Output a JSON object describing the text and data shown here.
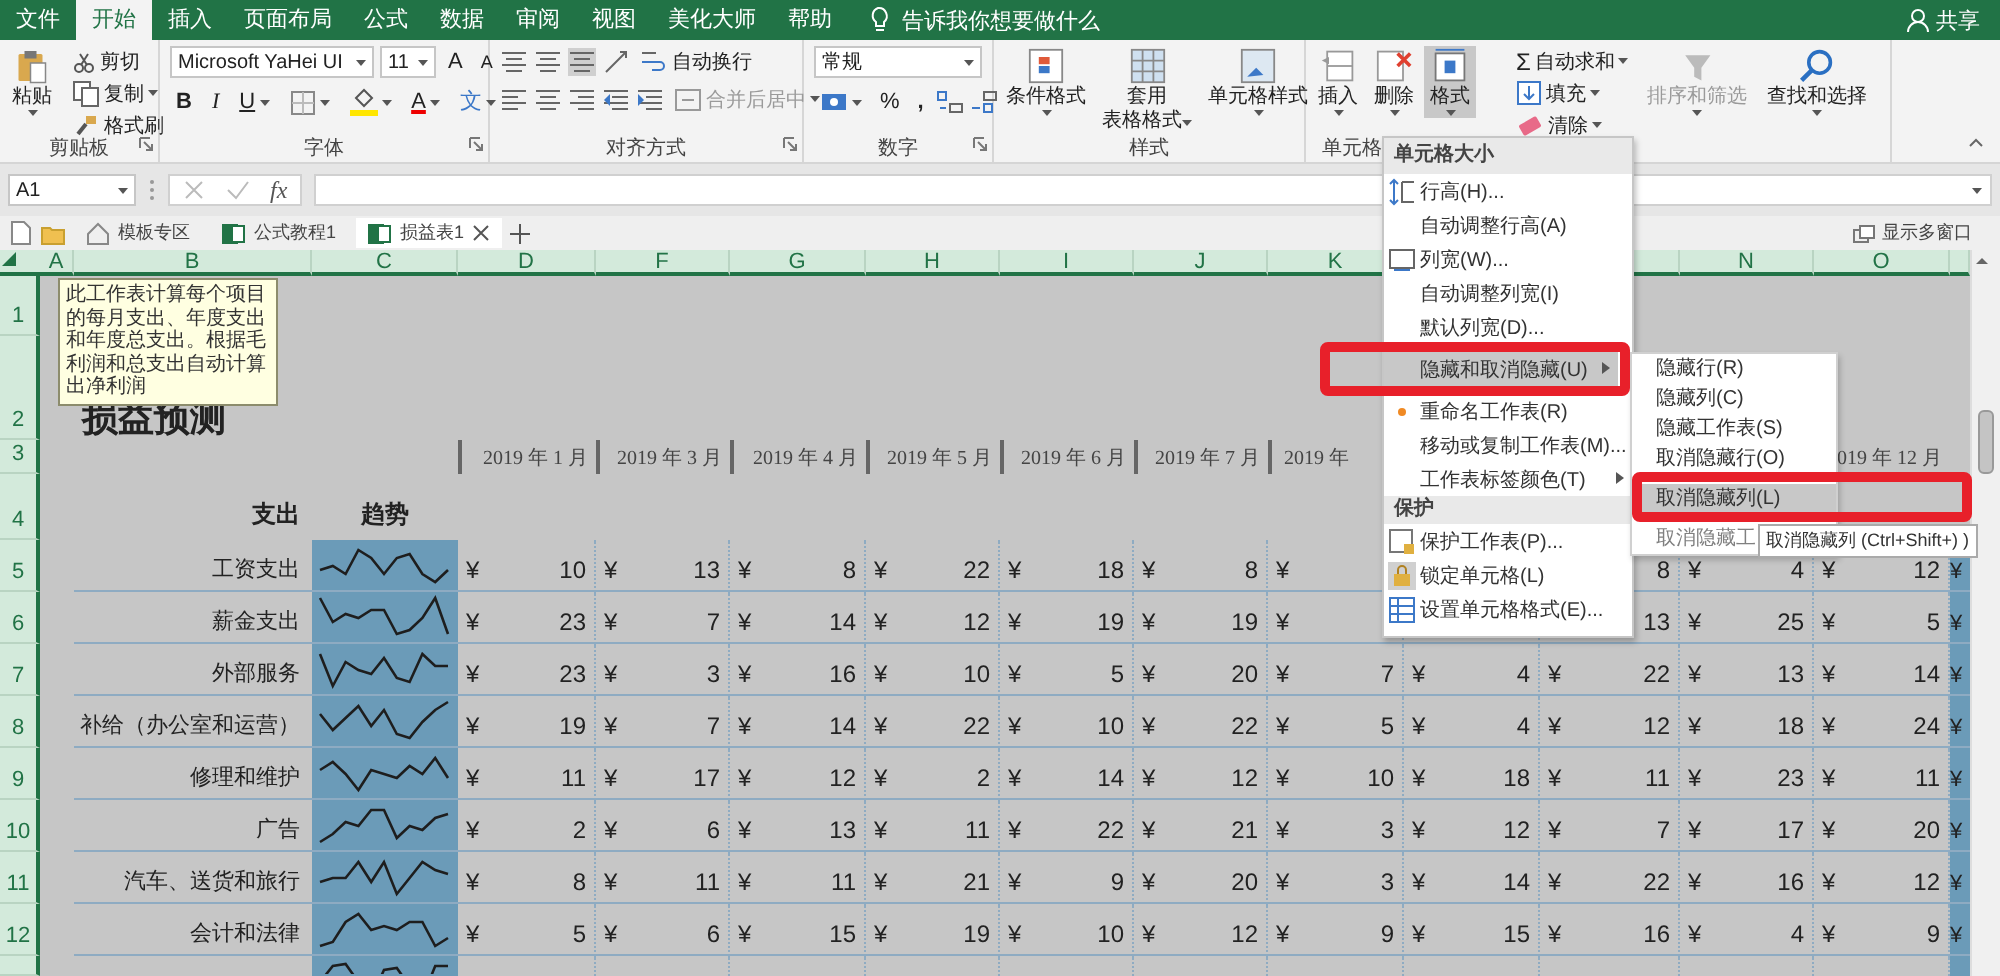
{
  "ribbon_tabs": [
    {
      "label": "文件",
      "selected": false
    },
    {
      "label": "开始",
      "selected": true
    },
    {
      "label": "插入",
      "selected": false
    },
    {
      "label": "页面布局",
      "selected": false
    },
    {
      "label": "公式",
      "selected": false
    },
    {
      "label": "数据",
      "selected": false
    },
    {
      "label": "审阅",
      "selected": false
    },
    {
      "label": "视图",
      "selected": false
    },
    {
      "label": "美化大师",
      "selected": false
    },
    {
      "label": "帮助",
      "selected": false
    }
  ],
  "tell_me": "告诉我你想要做什么",
  "share": "共享",
  "clipboard": {
    "paste": "粘贴",
    "cut": "剪切",
    "copy": "复制",
    "format_painter": "格式刷",
    "label": "剪贴板"
  },
  "font": {
    "name": "Microsoft YaHei UI",
    "size": "11",
    "grow": "A",
    "shrink": "A",
    "bold": "B",
    "italic": "I",
    "underline": "U",
    "font_color": "A",
    "phonetic": "文",
    "label": "字体"
  },
  "alignment": {
    "wrap": "自动换行",
    "merge": "合并后居中",
    "merge_disabled": true,
    "label": "对齐方式"
  },
  "number": {
    "format": "常规",
    "percent": "%",
    "comma": ",",
    "label": "数字"
  },
  "styles": {
    "conditional": "条件格式",
    "table": [
      "套用",
      "表格格式"
    ],
    "cell_styles": "单元格样式",
    "label": "样式"
  },
  "cells": {
    "insert": "插入",
    "delete": "删除",
    "format": "格式",
    "format_selected": true,
    "label": "单元格"
  },
  "editing": {
    "sum_sign": "Σ",
    "autosum": "自动求和",
    "fill": "填充",
    "clear": "清除",
    "sort": "排序和筛选",
    "sort_disabled": true,
    "find": "查找和选择"
  },
  "formula_bar": {
    "name_box": "A1",
    "fx": "fx"
  },
  "doc_tabs": [
    {
      "label": "模板专区",
      "kind": "home",
      "selected": false
    },
    {
      "label": "公式教程1",
      "kind": "excel",
      "selected": false
    },
    {
      "label": "损益表1",
      "kind": "excel",
      "selected": true
    }
  ],
  "multi_window": "显示多窗口",
  "columns": [
    {
      "label": "A"
    },
    {
      "label": "B"
    },
    {
      "label": "C"
    },
    {
      "label": "D"
    },
    {
      "label": "F"
    },
    {
      "label": "G"
    },
    {
      "label": "H"
    },
    {
      "label": "I"
    },
    {
      "label": "J"
    },
    {
      "label": "K"
    },
    {},
    {},
    {
      "label": "N"
    },
    {
      "label": "O"
    },
    {}
  ],
  "tooltip": "此工作表计算每个项目的每月支出、年度支出和年度总支出。根据毛利润和总支出自动计算出净利润",
  "rows": [
    {
      "kind": "blank",
      "num": "1"
    },
    {
      "kind": "title",
      "num": "2",
      "title": "损益预测"
    },
    {
      "kind": "dates",
      "num": "3",
      "dates": [
        {
          "text": "2019 年 1 月"
        },
        {
          "text": "2019 年 3 月"
        },
        {
          "text": "2019 年 4 月"
        },
        {
          "text": "2019 年 5 月"
        },
        {
          "text": "2019 年 6 月"
        },
        {
          "text": "2019 年 7 月"
        },
        {
          "text": "2019 年"
        }
      ],
      "last_date": "019 年 12 月"
    },
    {
      "kind": "headers",
      "num": "4",
      "expense": "支出",
      "trend": "趋势"
    },
    {
      "kind": "expense",
      "num": "5",
      "label": "工资支出",
      "p": "¥",
      "cells": [
        {
          "currency": "¥",
          "value": "10"
        },
        {
          "currency": "¥",
          "value": "13"
        },
        {
          "currency": "¥",
          "value": "8"
        },
        {
          "currency": "¥",
          "value": "22"
        },
        {
          "currency": "¥",
          "value": "18"
        },
        {
          "currency": "¥",
          "value": "8"
        },
        {
          "currency": "¥"
        },
        {},
        {
          "value": "8"
        },
        {
          "currency": "¥",
          "value": "4"
        },
        {
          "currency": "¥",
          "value": "12"
        }
      ]
    },
    {
      "kind": "expense",
      "num": "6",
      "label": "薪金支出",
      "p": "¥",
      "cells": [
        {
          "currency": "¥",
          "value": "23"
        },
        {
          "currency": "¥",
          "value": "7"
        },
        {
          "currency": "¥",
          "value": "14"
        },
        {
          "currency": "¥",
          "value": "12"
        },
        {
          "currency": "¥",
          "value": "19"
        },
        {
          "currency": "¥",
          "value": "19"
        },
        {
          "currency": "¥"
        },
        {},
        {
          "value": "13"
        },
        {
          "currency": "¥",
          "value": "25"
        },
        {
          "currency": "¥",
          "value": "5"
        }
      ]
    },
    {
      "kind": "expense",
      "num": "7",
      "label": "外部服务",
      "p": "¥",
      "cells": [
        {
          "currency": "¥",
          "value": "23"
        },
        {
          "currency": "¥",
          "value": "3"
        },
        {
          "currency": "¥",
          "value": "16"
        },
        {
          "currency": "¥",
          "value": "10"
        },
        {
          "currency": "¥",
          "value": "5"
        },
        {
          "currency": "¥",
          "value": "20"
        },
        {
          "currency": "¥",
          "value": "7"
        },
        {
          "currency": "¥",
          "value": "4"
        },
        {
          "currency": "¥",
          "value": "22"
        },
        {
          "currency": "¥",
          "value": "13"
        },
        {
          "currency": "¥",
          "value": "14"
        }
      ]
    },
    {
      "kind": "expense",
      "num": "8",
      "label": "补给（办公室和运营）",
      "p": "¥",
      "cells": [
        {
          "currency": "¥",
          "value": "19"
        },
        {
          "currency": "¥",
          "value": "7"
        },
        {
          "currency": "¥",
          "value": "14"
        },
        {
          "currency": "¥",
          "value": "22"
        },
        {
          "currency": "¥",
          "value": "10"
        },
        {
          "currency": "¥",
          "value": "22"
        },
        {
          "currency": "¥",
          "value": "5"
        },
        {
          "currency": "¥",
          "value": "4"
        },
        {
          "currency": "¥",
          "value": "12"
        },
        {
          "currency": "¥",
          "value": "18"
        },
        {
          "currency": "¥",
          "value": "24"
        }
      ]
    },
    {
      "kind": "expense",
      "num": "9",
      "label": "修理和维护",
      "p": "¥",
      "cells": [
        {
          "currency": "¥",
          "value": "11"
        },
        {
          "currency": "¥",
          "value": "17"
        },
        {
          "currency": "¥",
          "value": "12"
        },
        {
          "currency": "¥",
          "value": "2"
        },
        {
          "currency": "¥",
          "value": "14"
        },
        {
          "currency": "¥",
          "value": "12"
        },
        {
          "currency": "¥",
          "value": "10"
        },
        {
          "currency": "¥",
          "value": "18"
        },
        {
          "currency": "¥",
          "value": "11"
        },
        {
          "currency": "¥",
          "value": "23"
        },
        {
          "currency": "¥",
          "value": "11"
        }
      ]
    },
    {
      "kind": "expense",
      "num": "10",
      "label": "广告",
      "p": "¥",
      "cells": [
        {
          "currency": "¥",
          "value": "2"
        },
        {
          "currency": "¥",
          "value": "6"
        },
        {
          "currency": "¥",
          "value": "13"
        },
        {
          "currency": "¥",
          "value": "11"
        },
        {
          "currency": "¥",
          "value": "22"
        },
        {
          "currency": "¥",
          "value": "21"
        },
        {
          "currency": "¥",
          "value": "3"
        },
        {
          "currency": "¥",
          "value": "12"
        },
        {
          "currency": "¥",
          "value": "7"
        },
        {
          "currency": "¥",
          "value": "17"
        },
        {
          "currency": "¥",
          "value": "20"
        }
      ]
    },
    {
      "kind": "expense",
      "num": "11",
      "label": "汽车、送货和旅行",
      "p": "¥",
      "cells": [
        {
          "currency": "¥",
          "value": "8"
        },
        {
          "currency": "¥",
          "value": "11"
        },
        {
          "currency": "¥",
          "value": "11"
        },
        {
          "currency": "¥",
          "value": "21"
        },
        {
          "currency": "¥",
          "value": "9"
        },
        {
          "currency": "¥",
          "value": "20"
        },
        {
          "currency": "¥",
          "value": "3"
        },
        {
          "currency": "¥",
          "value": "14"
        },
        {
          "currency": "¥",
          "value": "22"
        },
        {
          "currency": "¥",
          "value": "16"
        },
        {
          "currency": "¥",
          "value": "12"
        }
      ]
    },
    {
      "kind": "expense",
      "num": "12",
      "label": "会计和法律",
      "p": "¥",
      "cells": [
        {
          "currency": "¥",
          "value": "5"
        },
        {
          "currency": "¥",
          "value": "6"
        },
        {
          "currency": "¥",
          "value": "15"
        },
        {
          "currency": "¥",
          "value": "19"
        },
        {
          "currency": "¥",
          "value": "10"
        },
        {
          "currency": "¥",
          "value": "12"
        },
        {
          "currency": "¥",
          "value": "9"
        },
        {
          "currency": "¥",
          "value": "15"
        },
        {
          "currency": "¥",
          "value": "16"
        },
        {
          "currency": "¥",
          "value": "4"
        },
        {
          "currency": "¥",
          "value": "9"
        }
      ]
    },
    {
      "kind": "partial"
    }
  ],
  "format_menu": [
    {
      "kind": "header",
      "label": "单元格大小"
    },
    {
      "kind": "item",
      "label": "行高(H)...",
      "selected": false,
      "has_submenu": false
    },
    {
      "kind": "item",
      "label": "自动调整行高(A)",
      "selected": false,
      "has_submenu": false
    },
    {
      "kind": "item",
      "label": "列宽(W)...",
      "selected": false,
      "has_submenu": false
    },
    {
      "kind": "item",
      "label": "自动调整列宽(I)",
      "selected": false,
      "has_submenu": false
    },
    {
      "kind": "item",
      "label": "默认列宽(D)...",
      "selected": false,
      "has_submenu": false
    },
    {
      "kind": "item",
      "label": "隐藏和取消隐藏(U)",
      "selected": true,
      "has_submenu": true
    },
    {
      "kind": "item",
      "label": "重命名工作表(R)",
      "selected": false,
      "has_submenu": false
    },
    {
      "kind": "item",
      "label": "移动或复制工作表(M)...",
      "selected": false,
      "has_submenu": false
    },
    {
      "kind": "item",
      "label": "工作表标签颜色(T)",
      "selected": false,
      "has_submenu": true
    },
    {
      "kind": "header",
      "label": "保护"
    },
    {
      "kind": "item",
      "label": "保护工作表(P)...",
      "selected": false,
      "has_submenu": false
    },
    {
      "kind": "item",
      "label": "锁定单元格(L)",
      "selected": false,
      "has_submenu": false
    },
    {
      "kind": "item",
      "label": "设置单元格格式(E)...",
      "selected": false,
      "has_submenu": false
    }
  ],
  "hide_submenu": [
    {
      "label": "隐藏行(R)",
      "selected": false,
      "disabled": false
    },
    {
      "label": "隐藏列(C)",
      "selected": false,
      "disabled": false
    },
    {
      "label": "隐藏工作表(S)",
      "selected": false,
      "disabled": false
    },
    {
      "label": "取消隐藏行(O)",
      "selected": false,
      "disabled": false
    },
    {
      "label": "取消隐藏列(L)",
      "selected": true,
      "disabled": false
    },
    {
      "label": "取消隐藏工",
      "selected": false,
      "disabled": true
    }
  ],
  "submenu_tooltip": "取消隐藏列 (Ctrl+Shift+) )"
}
